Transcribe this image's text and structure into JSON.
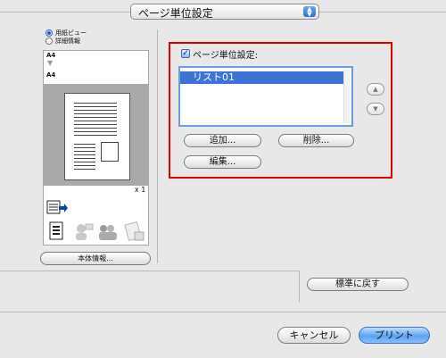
{
  "panel_select": {
    "value": "ページ単位設定"
  },
  "view_options": [
    {
      "label": "用紙ビュー",
      "selected": true
    },
    {
      "label": "詳細情報",
      "selected": false
    }
  ],
  "preview": {
    "paper_from": "A4",
    "paper_to": "A4",
    "copies": "x 1"
  },
  "printer_info_button": "本体情報...",
  "page_settings": {
    "checkbox_label": "ページ単位設定:",
    "checked": true,
    "list": [
      "リスト01"
    ],
    "add_button": "追加...",
    "delete_button": "削除...",
    "edit_button": "編集...",
    "move_up": "^",
    "move_down": "v"
  },
  "defaults_button": "標準に戻す",
  "cancel_button": "キャンセル",
  "print_button": "プリント",
  "colors": {
    "highlight": "#e00000",
    "selection": "#3a74d4",
    "primary_button": "#5aa3f2"
  }
}
